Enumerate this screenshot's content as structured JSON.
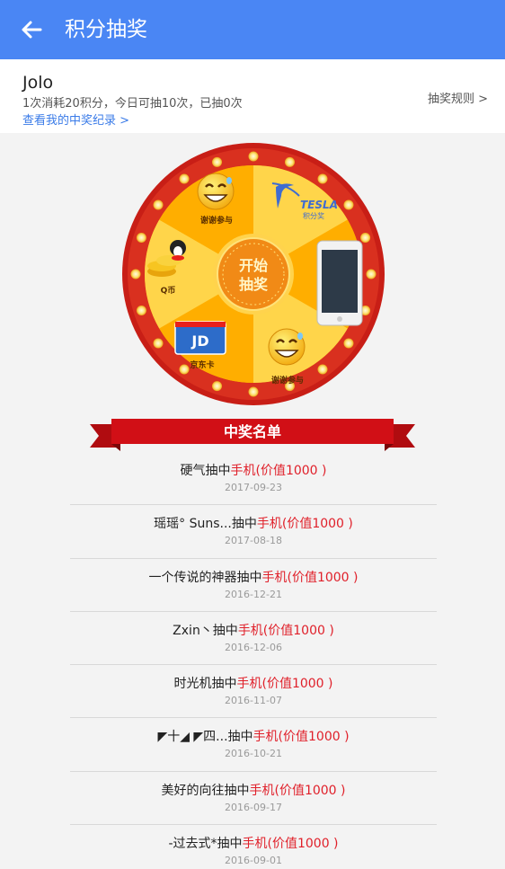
{
  "header": {
    "title": "积分抽奖",
    "back_icon": "arrow-left-icon"
  },
  "account": {
    "username": "Jolo",
    "summary": "1次消耗20积分，今日可抽10次，已抽0次",
    "record_link": "查看我的中奖纪录 >",
    "rules_link": "抽奖规则 >"
  },
  "wheel": {
    "center_label_line1": "开始",
    "center_label_line2": "抽奖",
    "brand_text": "TESLA",
    "slots": [
      "谢谢参与",
      "积分奖",
      "Q币",
      "京东卡",
      "谢谢参与"
    ]
  },
  "winners_title": "中奖名单",
  "winners": [
    {
      "name": "硬气抽中",
      "prize": "手机(价值1000 )",
      "date": "2017-09-23"
    },
    {
      "name": "瑶瑶° Suns...抽中",
      "prize": "手机(价值1000 )",
      "date": "2017-08-18"
    },
    {
      "name": "一个传说的神器抽中",
      "prize": "手机(价值1000 )",
      "date": "2016-12-21"
    },
    {
      "name": "Zxin丶抽中",
      "prize": "手机(价值1000 )",
      "date": "2016-12-06"
    },
    {
      "name": "时光机抽中",
      "prize": "手机(价值1000 )",
      "date": "2016-11-07"
    },
    {
      "name": "◤十◢ ◤四...抽中",
      "prize": "手机(价值1000 )",
      "date": "2016-10-21"
    },
    {
      "name": "美好的向往抽中",
      "prize": "手机(价值1000 )",
      "date": "2016-09-17"
    },
    {
      "name": "-过去式*抽中",
      "prize": "手机(价值1000 )",
      "date": "2016-09-01"
    }
  ],
  "colors": {
    "appbar": "#4a86f4",
    "link": "#3a7be8",
    "prize": "#e0202a",
    "banner": "#d10f16",
    "wheel_rim": "#d42a1c"
  }
}
